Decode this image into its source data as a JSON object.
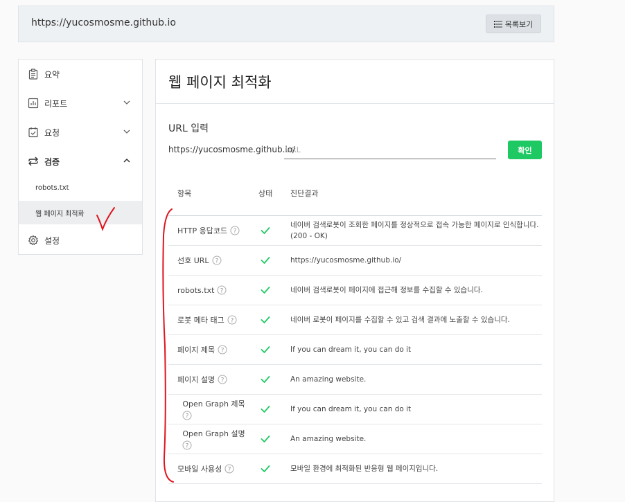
{
  "header": {
    "site_url": "https://yucosmosme.github.io",
    "list_button": "목록보기"
  },
  "sidebar": {
    "items": [
      {
        "label": "요약",
        "icon": "clipboard-icon"
      },
      {
        "label": "리포트",
        "icon": "bar-chart-icon"
      },
      {
        "label": "요청",
        "icon": "checklist-icon"
      },
      {
        "label": "검증",
        "icon": "swap-arrows-icon"
      },
      {
        "label": "설정",
        "icon": "gear-icon"
      }
    ],
    "sub_items": [
      {
        "label": "robots.txt"
      },
      {
        "label": "웹 페이지 최적화"
      }
    ]
  },
  "main": {
    "title": "웹 페이지 최적화",
    "url_section": {
      "label": "URL 입력",
      "prefix": "https://yucosmosme.github.io/",
      "placeholder": "URL",
      "confirm": "확인"
    },
    "table": {
      "headers": [
        "항목",
        "상태",
        "진단결과"
      ],
      "rows": [
        {
          "item": "HTTP 응답코드",
          "result": "네이버 검색로봇이 조회한 페이지를 정상적으로 접속 가능한 페이지로 인식합니다.(200 - OK)"
        },
        {
          "item": "선호 URL",
          "result": "https://yucosmosme.github.io/"
        },
        {
          "item": "robots.txt",
          "result": "네이버 검색로봇이 페이지에 접근해 정보를 수집할 수 있습니다."
        },
        {
          "item": "로봇 메타 태그",
          "result": "네이버 로봇이 페이지를 수집할 수 있고 검색 결과에 노출할 수 있습니다."
        },
        {
          "item": "페이지 제목",
          "result": "If you can dream it, you can do it"
        },
        {
          "item": "페이지 설명",
          "result": "An amazing website."
        },
        {
          "item": "Open Graph 제목",
          "result": "If you can dream it, you can do it"
        },
        {
          "item": "Open Graph 설명",
          "result": "An amazing website."
        },
        {
          "item": "모바일 사용성",
          "result": "모바일 환경에 최적화된 반응형 웹 페이지입니다."
        }
      ]
    }
  },
  "colors": {
    "accent_green": "#1ec963",
    "annotation_red": "#e0141e"
  }
}
